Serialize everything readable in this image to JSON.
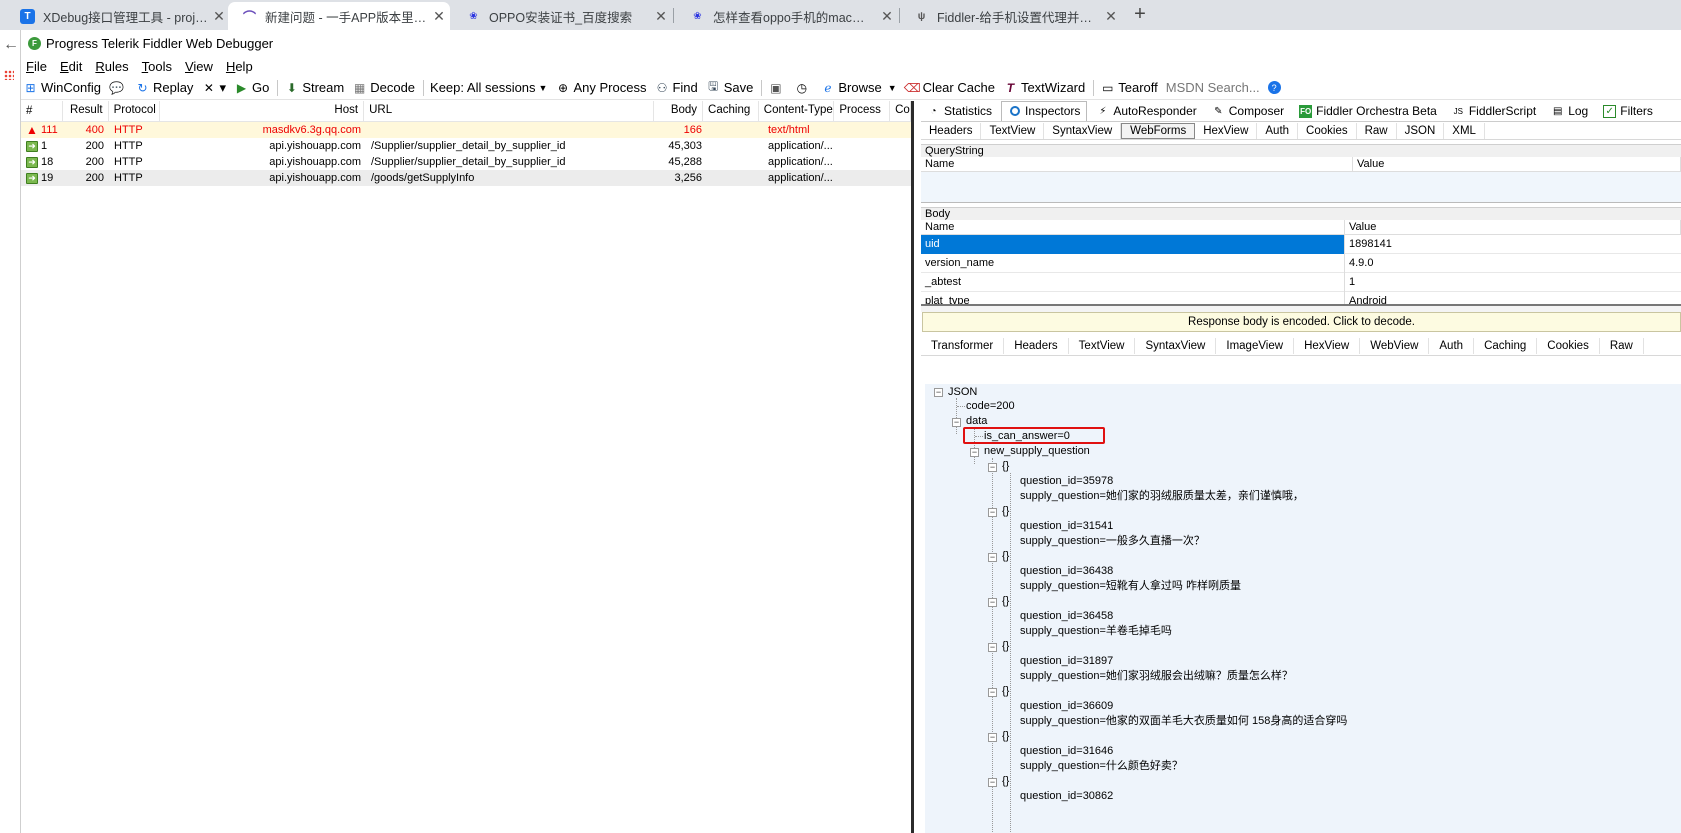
{
  "browser_tabs": [
    {
      "title": "XDebug接口管理工具 - project",
      "icon": "xdebug-icon"
    },
    {
      "title": "新建问题 - 一手APP版本里程碑",
      "icon": "gitlab-icon"
    },
    {
      "title": "OPPO安装证书_百度搜索",
      "icon": "baidu-paw-icon"
    },
    {
      "title": "怎样查看oppo手机的mac地址并",
      "icon": "baidu-paw-icon"
    },
    {
      "title": "Fiddler-给手机设置代理并抓取h",
      "icon": "fiddler-icon"
    }
  ],
  "new_tab": "+",
  "window": {
    "title": "Progress Telerik Fiddler Web Debugger"
  },
  "menu": [
    "File",
    "Edit",
    "Rules",
    "Tools",
    "View",
    "Help"
  ],
  "toolbar": {
    "winconfig": "WinConfig",
    "replay": "Replay",
    "remove": "▾",
    "go": "Go",
    "stream": "Stream",
    "decode": "Decode",
    "keep": "Keep: All sessions",
    "process": "Any Process",
    "find": "Find",
    "save": "Save",
    "browse": "Browse",
    "clear_cache": "Clear Cache",
    "textwizard": "TextWizard",
    "tearoff": "Tearoff",
    "msdn": "MSDN Search..."
  },
  "sessions": {
    "columns": [
      "#",
      "Result",
      "Protocol",
      "Host",
      "URL",
      "Body",
      "Caching",
      "Content-Type",
      "Process",
      "Con"
    ],
    "rows": [
      {
        "num": "111",
        "result": "400",
        "protocol": "HTTP",
        "host": "masdkv6.3g.qq.com",
        "url": "",
        "body": "166",
        "caching": "",
        "ctype": "text/html"
      },
      {
        "num": "1",
        "result": "200",
        "protocol": "HTTP",
        "host": "api.yishouapp.com",
        "url": "/Supplier/supplier_detail_by_supplier_id",
        "body": "45,303",
        "caching": "",
        "ctype": "application/..."
      },
      {
        "num": "18",
        "result": "200",
        "protocol": "HTTP",
        "host": "api.yishouapp.com",
        "url": "/Supplier/supplier_detail_by_supplier_id",
        "body": "45,288",
        "caching": "",
        "ctype": "application/..."
      },
      {
        "num": "19",
        "result": "200",
        "protocol": "HTTP",
        "host": "api.yishouapp.com",
        "url": "/goods/getSupplyInfo",
        "body": "3,256",
        "caching": "",
        "ctype": "application/..."
      }
    ]
  },
  "inspector": {
    "top_tabs": [
      "Statistics",
      "Inspectors",
      "AutoResponder",
      "Composer",
      "Fiddler Orchestra Beta",
      "FiddlerScript",
      "Log",
      "Filters"
    ],
    "request_tabs": [
      "Headers",
      "TextView",
      "SyntaxView",
      "WebForms",
      "HexView",
      "Auth",
      "Cookies",
      "Raw",
      "JSON",
      "XML"
    ],
    "querystring_label": "QueryString",
    "body_label": "Body",
    "name_col": "Name",
    "value_col": "Value",
    "body_rows": [
      {
        "name": "uid",
        "value": "1898141"
      },
      {
        "name": "version_name",
        "value": "4.9.0"
      },
      {
        "name": "_abtest",
        "value": "1"
      },
      {
        "name": "plat_type",
        "value": "Android"
      }
    ],
    "banner": "Response body is encoded. Click to decode.",
    "response_tabs": [
      "Transformer",
      "Headers",
      "TextView",
      "SyntaxView",
      "ImageView",
      "HexView",
      "WebView",
      "Auth",
      "Caching",
      "Cookies",
      "Raw"
    ]
  },
  "tree": {
    "root": "JSON",
    "code": "code=200",
    "data": "data",
    "is_can_answer": "is_can_answer=0",
    "new_supply_question": "new_supply_question",
    "obj": "{}",
    "items": [
      {
        "id": "question_id=35978",
        "q": "supply_question=她们家的羽绒服质量太差，亲们谨慎哦，"
      },
      {
        "id": "question_id=31541",
        "q": "supply_question=一般多久直播一次？"
      },
      {
        "id": "question_id=36438",
        "q": "supply_question=短靴有人拿过吗 咋样咧质量"
      },
      {
        "id": "question_id=36458",
        "q": "supply_question=羊卷毛掉毛吗"
      },
      {
        "id": "question_id=31897",
        "q": "supply_question=她们家羽绒服会出绒嘛？质量怎么样？"
      },
      {
        "id": "question_id=36609",
        "q": "supply_question=他家的双面羊毛大衣质量如何 158身高的适合穿吗"
      },
      {
        "id": "question_id=31646",
        "q": "supply_question=什么颜色好卖？"
      },
      {
        "id": "question_id=30862",
        "q": ""
      }
    ]
  },
  "colors": {
    "highlight": "#e01010",
    "selected": "#0078d7",
    "error": "#e00000"
  }
}
